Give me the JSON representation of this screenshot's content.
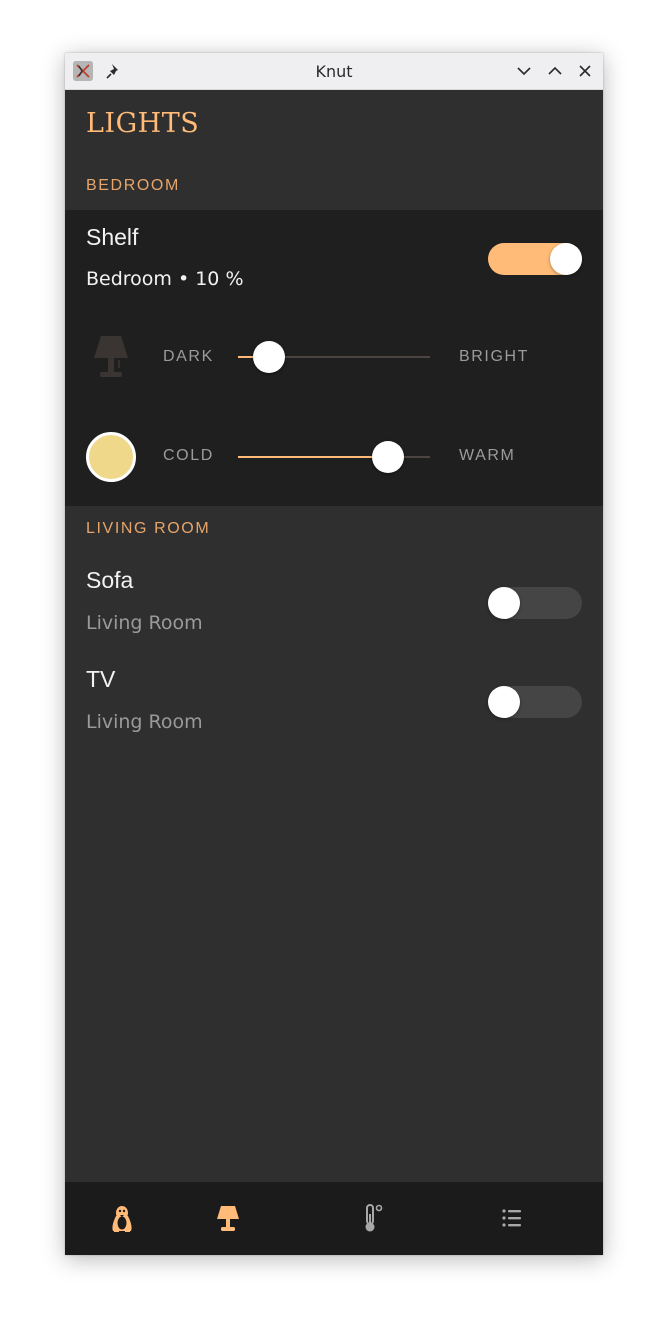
{
  "window": {
    "title": "Knut"
  },
  "page": {
    "title": "LIGHTS"
  },
  "sections": [
    {
      "header": "BEDROOM",
      "lights": [
        {
          "name": "Shelf",
          "subtitle": "Bedroom • 10 %",
          "on": true,
          "brightness": {
            "label_min": "DARK",
            "label_max": "BRIGHT",
            "value_percent": 10
          },
          "temperature": {
            "label_min": "COLD",
            "label_max": "WARM",
            "value_percent": 78
          },
          "color": "#efd88a"
        }
      ]
    },
    {
      "header": "LIVING ROOM",
      "lights": [
        {
          "name": "Sofa",
          "subtitle": "Living Room",
          "on": false
        },
        {
          "name": "TV",
          "subtitle": "Living Room",
          "on": false
        }
      ]
    }
  ],
  "nav": {
    "items": [
      {
        "icon": "penguin-icon",
        "active": true
      },
      {
        "icon": "lamp-icon",
        "active": true
      },
      {
        "icon": "thermometer-icon",
        "active": false
      },
      {
        "icon": "checklist-icon",
        "active": false
      }
    ]
  },
  "colors": {
    "accent": "#ffbb77",
    "background": "#2f2f2f",
    "card": "#1f1f1f",
    "nav": "#1b1b1b"
  }
}
